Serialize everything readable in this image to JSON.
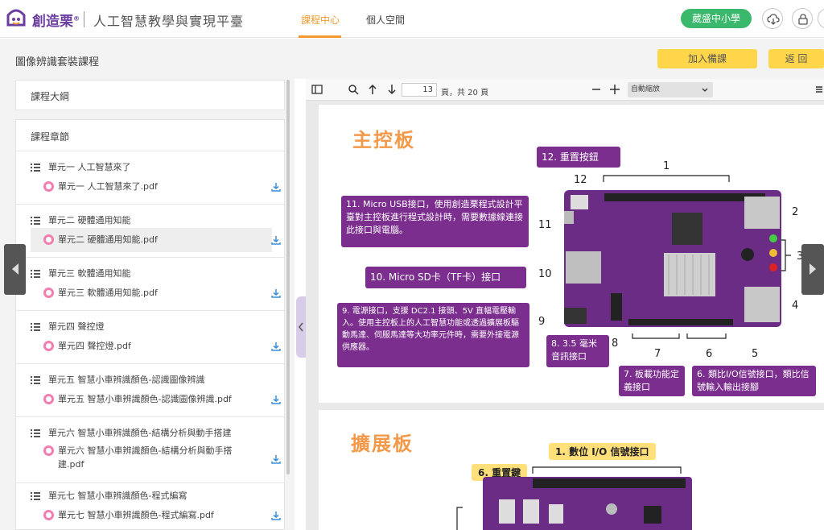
{
  "header": {
    "brand": "創造栗",
    "brand_mark": "®",
    "site_title": "人工智慧教學與實現平臺",
    "tabs": [
      {
        "label": "課程中心",
        "active": true
      },
      {
        "label": "個人空間",
        "active": false
      }
    ],
    "school_badge": "葳盛中小學",
    "icons": [
      "cloud-download-icon",
      "lock-icon",
      "user-icon"
    ],
    "accent_color": "#f29a2e",
    "badge_color": "#3ab86b"
  },
  "course": {
    "title": "圖像辨識套裝課程",
    "join_button": "加入備課",
    "back_button": "返 回"
  },
  "sidebar": {
    "outline_label": "課程大綱",
    "chapters_label": "課程章節",
    "units": [
      {
        "title": "單元一 人工智慧來了",
        "file": "單元一 人工智慧來了.pdf"
      },
      {
        "title": "單元二 硬體通用知能",
        "file": "單元二 硬體通用知能.pdf"
      },
      {
        "title": "單元三 軟體通用知能",
        "file": "單元三 軟體通用知能.pdf"
      },
      {
        "title": "單元四 聲控燈",
        "file": "單元四 聲控燈.pdf"
      },
      {
        "title": "單元五 智慧小車辨識顏色-認識圖像辨識",
        "file": "單元五 智慧小車辨識顏色-認識圖像辨識.pdf"
      },
      {
        "title": "單元六 智慧小車辨識顏色-結構分析與動手搭建",
        "file": "單元六 智慧小車辨識顏色-結構分析與動手搭",
        "file2": "建.pdf"
      },
      {
        "title": "單元七 智慧小車辨識顏色-程式編寫",
        "file": "單元七 智慧小車辨識顏色-程式編寫.pdf"
      }
    ]
  },
  "viewer": {
    "current_page": "13",
    "page_total": "頁，共 20 頁",
    "zoom": "自動縮放",
    "page1": {
      "heading": "主控板",
      "labels": {
        "l12_box": "12. 重置按鈕",
        "l11_box": "11. Micro USB接口，使用創造栗程式設計平臺對主控板進行程式設計時，需要數據線連接此接口與電腦。",
        "l10_box": "10. Micro SD卡（TF卡）接口",
        "l9_box": "9. 電源接口，支援 DC2.1 接頭、5V 直幅電壓輸入。使用主控板上的人工智慧功能或透過擴展板驅動馬達、伺服馬達等大功率元件時，需要外接電源供應器。",
        "l8_box": "8. 3.5 毫米音訊接口",
        "l7_box": "7. 板載功能定義接口",
        "l6_box": "6. 類比I/O信號接口，類比信號輸入輸出接腳"
      },
      "numbers": [
        "1",
        "2",
        "3",
        "4",
        "5",
        "6",
        "7",
        "8",
        "9",
        "10",
        "11",
        "12"
      ]
    },
    "page2": {
      "heading": "擴展板",
      "labels": {
        "l1_box": "1. 數位 I/O 信號接口",
        "l6_box": "6. 重置鍵"
      }
    }
  }
}
